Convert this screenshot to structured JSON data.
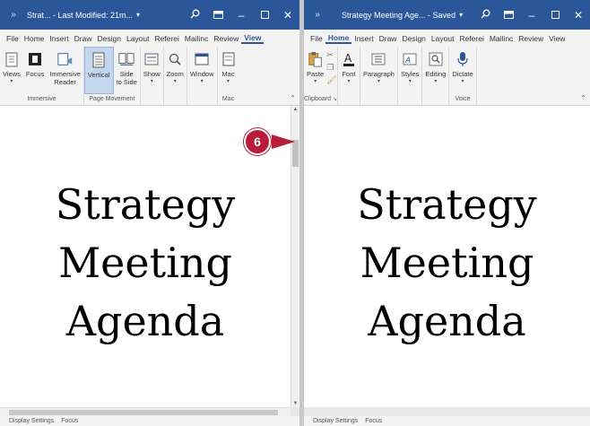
{
  "left_window": {
    "qat": "»",
    "title": "Strat... - Last Modified: 21m...",
    "title_caret": "▾",
    "tabs": [
      "File",
      "Home",
      "Insert",
      "Draw",
      "Design",
      "Layout",
      "Referei",
      "Mailinc",
      "Review",
      "View"
    ],
    "active_tab": "View",
    "groups": {
      "immersive": {
        "label": "Immersive",
        "views": "Views",
        "focus": "Focus",
        "immersive_reader_1": "Immersive",
        "immersive_reader_2": "Reader"
      },
      "page_movement": {
        "label": "Page Movement",
        "vertical": "Vertical",
        "side_1": "Side",
        "side_2": "to Side"
      },
      "show": "Show",
      "zoom": "Zoom",
      "window": "Window",
      "macros": "Mac",
      "macros_group_label": "Mac"
    },
    "document_lines": [
      "Strategy",
      "Meeting",
      "Agenda"
    ],
    "status": [
      "Display Settings",
      "Focus"
    ]
  },
  "right_window": {
    "qat": "»",
    "title": "Strategy Meeting Age... - Saved",
    "title_caret": "▾",
    "tabs": [
      "File",
      "Home",
      "Insert",
      "Draw",
      "Design",
      "Layout",
      "Referei",
      "Mailinc",
      "Review",
      "View"
    ],
    "active_tab": "Home",
    "groups": {
      "clipboard": {
        "label": "Clipboard",
        "paste": "Paste"
      },
      "font": "Font",
      "paragraph": "Paragraph",
      "styles": "Styles",
      "editing": "Editing",
      "voice": {
        "label": "Voice",
        "dictate": "Dictate"
      }
    },
    "document_lines": [
      "Strategy",
      "Meeting",
      "Agenda"
    ],
    "status": [
      "Display Settings",
      "Focus"
    ]
  },
  "callout": {
    "number": "6",
    "color": "#b81c3a"
  },
  "accent_color": "#2b579a"
}
